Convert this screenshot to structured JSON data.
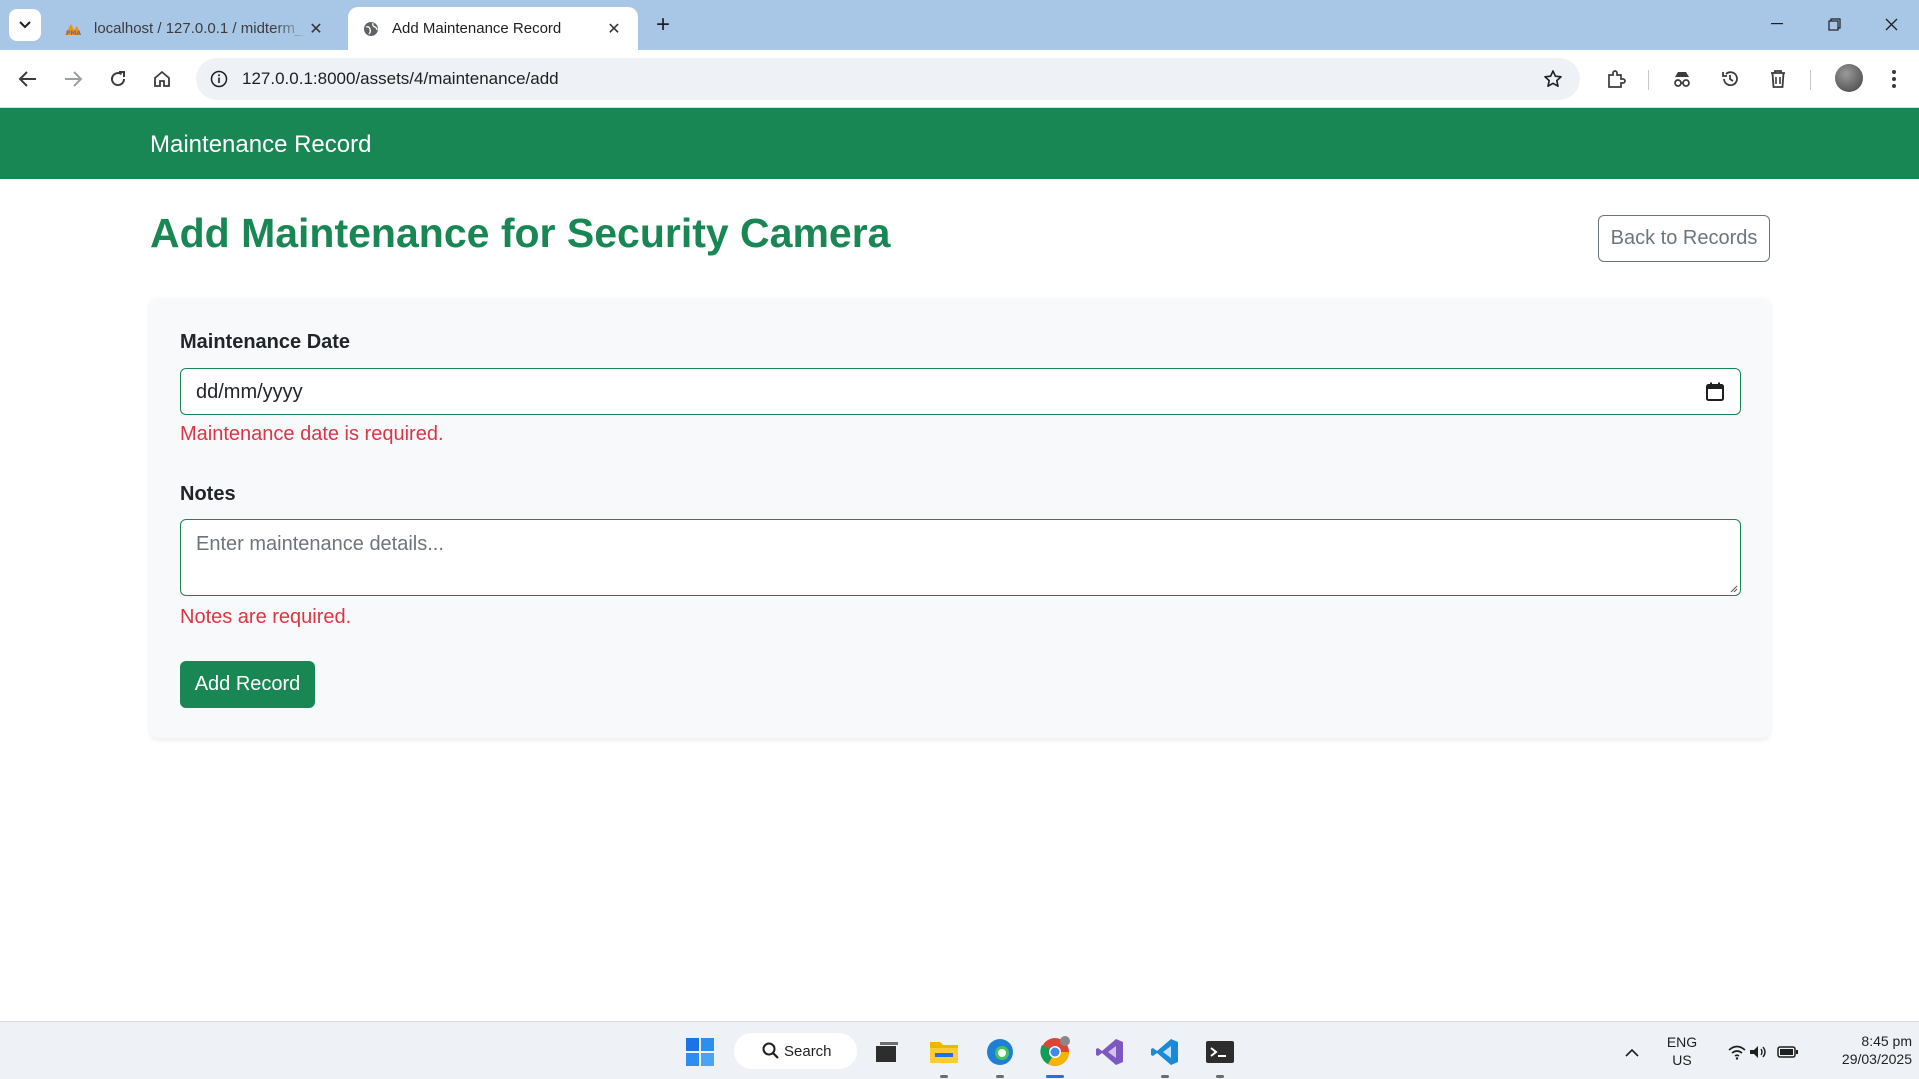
{
  "browser": {
    "tabs": [
      {
        "title": "localhost / 127.0.0.1 / midterm_",
        "active": false
      },
      {
        "title": "Add Maintenance Record",
        "active": true
      }
    ],
    "url": "127.0.0.1:8000/assets/4/maintenance/add"
  },
  "navbar": {
    "brand": "Maintenance Record",
    "color": "#198754"
  },
  "page": {
    "title": "Add Maintenance for Security Camera",
    "back_button": "Back to Records"
  },
  "form": {
    "date_label": "Maintenance Date",
    "date_value": "dd/mm/yyyy",
    "date_error": "Maintenance date is required.",
    "notes_label": "Notes",
    "notes_placeholder": "Enter maintenance details...",
    "notes_error": "Notes are required.",
    "submit_label": "Add Record",
    "error_color": "#dc3545"
  },
  "taskbar": {
    "search_label": "Search",
    "language": {
      "line1": "ENG",
      "line2": "US"
    },
    "time": "8:45 pm",
    "date": "29/03/2025",
    "apps": [
      "windows-start-icon",
      "task-view-icon",
      "file-explorer-icon",
      "edge-icon",
      "chrome-icon",
      "visual-studio-icon",
      "vscode-icon",
      "terminal-icon"
    ]
  }
}
